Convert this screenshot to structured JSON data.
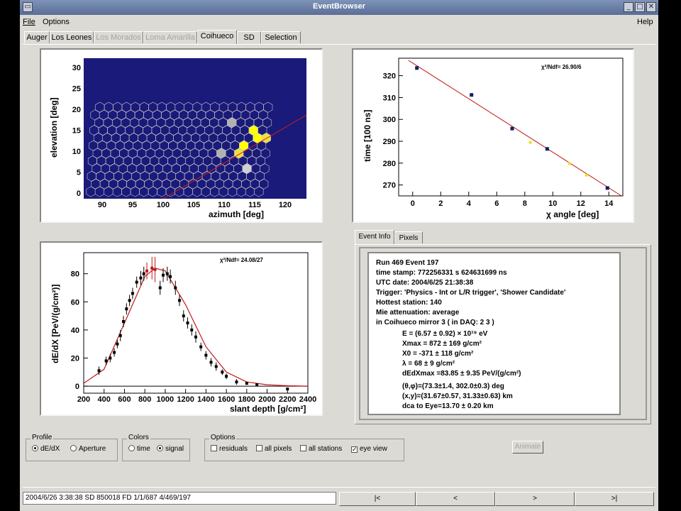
{
  "window": {
    "title": "EventBrowser"
  },
  "menu": {
    "file": "File",
    "options": "Options",
    "help": "Help"
  },
  "tabs": [
    {
      "label": "Auger",
      "enabled": true
    },
    {
      "label": "Los Leones",
      "enabled": true
    },
    {
      "label": "Los Morados",
      "enabled": false
    },
    {
      "label": "Loma Amarilla",
      "enabled": false
    },
    {
      "label": "Coihueco",
      "enabled": true,
      "selected": true
    },
    {
      "label": "SD",
      "enabled": true
    },
    {
      "label": "Selection",
      "enabled": true
    }
  ],
  "camera_plot": {
    "xlabel": "azimuth  [deg]",
    "ylabel": "elevation [deg]",
    "xticks": [
      "90",
      "95",
      "100",
      "105",
      "110",
      "115",
      "120"
    ],
    "yticks": [
      "0",
      "5",
      "10",
      "15",
      "20",
      "25",
      "30"
    ],
    "background_color": "#1a1a7a",
    "pixel_color": "#c8c8c8",
    "hit_colors": [
      "#ffff00",
      "#f0e040",
      "#b0b0b0",
      "#d0d0d0"
    ]
  },
  "time_plot": {
    "xlabel": "χ angle [deg]",
    "ylabel": "time [100 ns]",
    "fit_label": "χ²/Ndf=  26.90/6",
    "xticks": [
      "0",
      "2",
      "4",
      "6",
      "8",
      "10",
      "12",
      "14"
    ],
    "yticks": [
      "270",
      "280",
      "290",
      "300",
      "310",
      "320"
    ]
  },
  "chart_data": [
    {
      "type": "scatter",
      "title": "",
      "xlabel": "χ angle [deg]",
      "ylabel": "time [100 ns]",
      "xlim": [
        -1,
        15
      ],
      "ylim": [
        265,
        328
      ],
      "annotation": "χ²/Ndf=  26.90/6",
      "series": [
        {
          "x": [
            0.3,
            4.2,
            7.1,
            9.6,
            13.9
          ],
          "y": [
            323.5,
            311.2,
            295.8,
            286.5,
            268.6
          ]
        },
        {
          "x": [
            8.4,
            11.2,
            12.4
          ],
          "y": [
            289.5,
            279.8,
            274.5
          ]
        }
      ],
      "fit_line": {
        "x": [
          -0.3,
          14.9
        ],
        "y": [
          327,
          265
        ]
      }
    },
    {
      "type": "scatter",
      "title": "",
      "xlabel": "slant depth [g/cm²]",
      "ylabel": "dE/dX [PeV/(g/cm²)]",
      "xlim": [
        200,
        2400
      ],
      "ylim": [
        -5,
        95
      ],
      "annotation": "χ²/Ndf=  24.08/27",
      "series": [
        {
          "x": [
            350,
            420,
            460,
            500,
            530,
            560,
            590,
            620,
            650,
            680,
            720,
            760,
            790,
            820,
            870,
            900,
            950,
            980,
            1020,
            1050,
            1100,
            1140,
            1180,
            1220,
            1260,
            1300,
            1350,
            1400,
            1450,
            1500,
            1560,
            1600,
            1700,
            1800,
            1900,
            2200
          ],
          "y": [
            11,
            18,
            20,
            24,
            30,
            36,
            46,
            55,
            61,
            66,
            74,
            77,
            80,
            82,
            84,
            83,
            70,
            79,
            80,
            78,
            70,
            61,
            50,
            45,
            40,
            35,
            28,
            22,
            17,
            14,
            10,
            7,
            3,
            2,
            1,
            -2
          ],
          "yerr": [
            3,
            3,
            3,
            3,
            3,
            4,
            4,
            4,
            4,
            4,
            4,
            5,
            5,
            6,
            8,
            9,
            5,
            5,
            5,
            5,
            5,
            4,
            4,
            4,
            4,
            4,
            3,
            3,
            3,
            3,
            2,
            2,
            2,
            1,
            1,
            1
          ]
        }
      ],
      "fit_curve": {
        "x": [
          200,
          400,
          600,
          800,
          900,
          1000,
          1200,
          1400,
          1600,
          1800,
          2000,
          2200,
          2400
        ],
        "y": [
          2,
          12,
          45,
          78,
          84,
          82,
          58,
          28,
          10,
          3,
          1,
          0.3,
          0
        ]
      }
    }
  ],
  "profile_plot": {
    "xlabel": "slant depth [g/cm²]",
    "ylabel": "dE/dX [PeV/(g/cm²)]",
    "fit_label": "χ²/Ndf=  24.08/27",
    "xticks": [
      "200",
      "400",
      "600",
      "800",
      "1000",
      "1200",
      "1400",
      "1600",
      "1800",
      "2000",
      "2200",
      "2400"
    ],
    "yticks": [
      "0",
      "20",
      "40",
      "60",
      "80"
    ]
  },
  "info_tabs": [
    "Event Info",
    "Pixels"
  ],
  "event_info": {
    "lines": [
      "Run 469 Event 197",
      "time stamp: 772256331 s 624631699 ns",
      "UTC date: 2004/6/25   21:38:38",
      "Trigger: 'Physics - Int or L/R trigger', 'Shower Candidate'",
      "Hottest station: 140",
      "Mie attenuation: average",
      "in Coihueco mirror 3 ( in DAQ:  2 3 )"
    ],
    "params": [
      "E = (6.57 ± 0.92) × 10¹⁹ eV",
      "Xmax    =   872 ±    169 g/cm²",
      "X0        =  -371 ±    118 g/cm²",
      "λ           =    68 ±      9 g/cm²",
      "dEdXmax =83.85 ± 9.35 PeV/(g/cm²)"
    ],
    "geometry": [
      "(θ,φ)=(73.3±1.4, 302.0±0.3) deg",
      "(x,y)=(31.67±0.57, 31.33±0.63) km",
      "dca to Eye=13.70 ± 0.20 km"
    ]
  },
  "profile_group": {
    "label": "Profile",
    "opt1": "dE/dX",
    "opt2": "Aperture"
  },
  "colors_group": {
    "label": "Colors",
    "opt1": "time",
    "opt2": "signal"
  },
  "options_group": {
    "label": "Options",
    "opt1": "residuals",
    "opt2": "all pixels",
    "opt3": "all stations",
    "opt4": "eye view"
  },
  "animate_label": "Animate",
  "status": "2004/6/26 3:38:38  SD 850018 FD 1/1/687 4/469/197",
  "nav": {
    "first": "|<",
    "prev": "<",
    "next": ">",
    "last": ">|"
  }
}
